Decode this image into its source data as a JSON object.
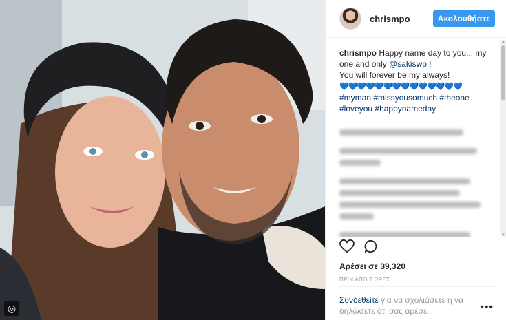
{
  "post": {
    "username": "chrismpo",
    "follow_label": "Ακολουθήστε",
    "caption_user": "chrismpo",
    "caption_text_1": "Happy name day to you... my one and only",
    "mention": "@sakiswp",
    "caption_text_2": "!",
    "caption_text_3": "You will forever be my always!",
    "hearts": "💙💙💙💙💙💙💙💙💙💙💙💙💙💙",
    "hashtags": [
      "#myman",
      "#missyousomuch",
      "#theone",
      "#loveyou",
      "#happynameday"
    ],
    "likes": "Αρέσει σε 39,320",
    "time": "ΠΡΙΝ ΑΠΟ 7 ΩΡΕΣ",
    "login_link": "Συνδεθείτε",
    "login_text": "για να σχολιάσετε ή να δηλώσετε ότι σας αρέσει.",
    "more_label": "•••"
  },
  "colors": {
    "accent": "#3897f0",
    "link": "#003569",
    "muted": "#999999",
    "text": "#262626"
  },
  "icons": {
    "like": "heart-icon",
    "comment": "comment-icon",
    "more": "more-options-icon",
    "photo_badge": "instagram-icon"
  }
}
